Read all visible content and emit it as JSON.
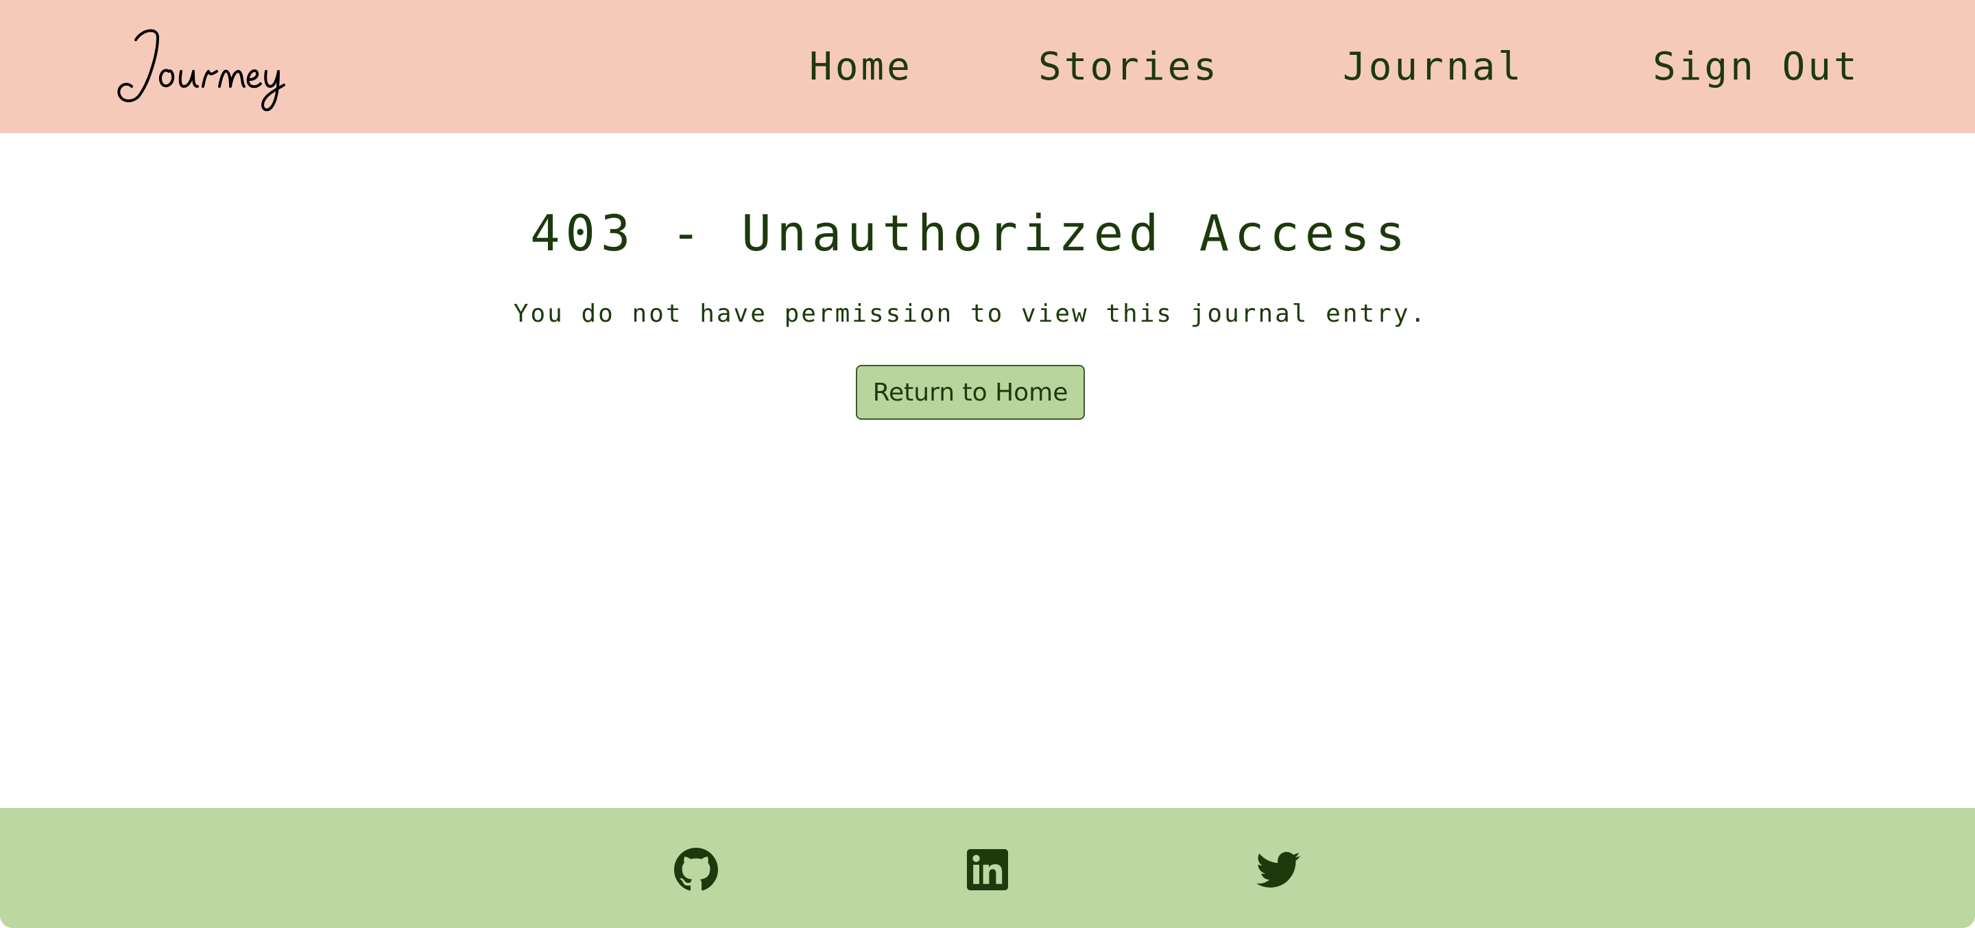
{
  "header": {
    "logo_text": "Journey",
    "nav": {
      "home": "Home",
      "stories": "Stories",
      "journal": "Journal",
      "sign_out": "Sign Out"
    }
  },
  "main": {
    "title": "403 - Unauthorized Access",
    "message": "You do not have permission to view this journal entry.",
    "return_button_label": "Return to Home"
  },
  "footer": {
    "icons": [
      "github-icon",
      "linkedin-icon",
      "twitter-icon"
    ]
  },
  "colors": {
    "header_bg": "#f6cabb",
    "footer_bg": "#bdd7a3",
    "button_bg": "#b9d59e",
    "text_dark_green": "#1c3a0c"
  }
}
